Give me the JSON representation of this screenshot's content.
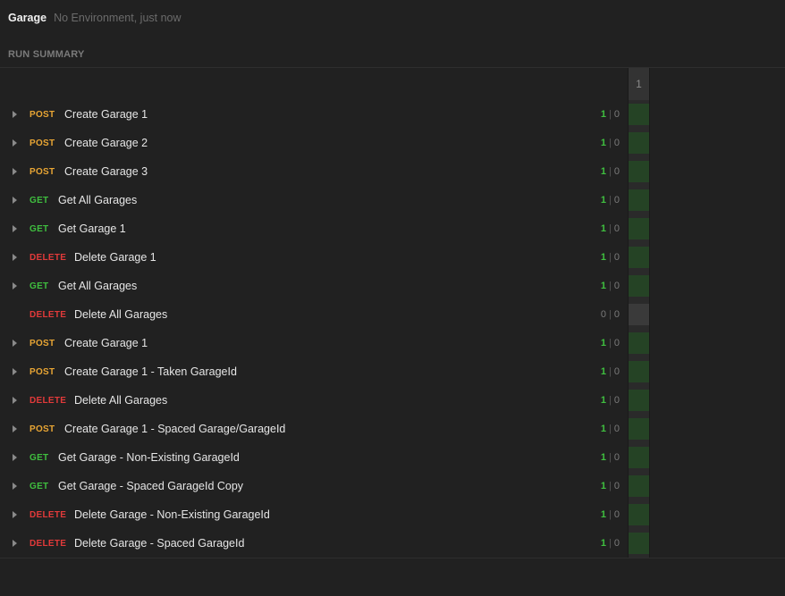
{
  "header": {
    "collection": "Garage",
    "meta": "No Environment, just now"
  },
  "section_label": "RUN SUMMARY",
  "iteration_label": "1",
  "colors": {
    "post": "#e8a534",
    "get": "#3fbf3f",
    "delete": "#e23a3a",
    "pass_cell": "#254325"
  },
  "requests": [
    {
      "method": "POST",
      "name": "Create Garage 1",
      "passed": "1",
      "failed": "0",
      "expandable": true
    },
    {
      "method": "POST",
      "name": "Create Garage 2",
      "passed": "1",
      "failed": "0",
      "expandable": true
    },
    {
      "method": "POST",
      "name": "Create Garage 3",
      "passed": "1",
      "failed": "0",
      "expandable": true
    },
    {
      "method": "GET",
      "name": "Get All Garages",
      "passed": "1",
      "failed": "0",
      "expandable": true
    },
    {
      "method": "GET",
      "name": "Get Garage 1",
      "passed": "1",
      "failed": "0",
      "expandable": true
    },
    {
      "method": "DELETE",
      "name": "Delete Garage 1",
      "passed": "1",
      "failed": "0",
      "expandable": true
    },
    {
      "method": "GET",
      "name": "Get All Garages",
      "passed": "1",
      "failed": "0",
      "expandable": true
    },
    {
      "method": "DELETE",
      "name": "Delete All Garages",
      "passed": "0",
      "failed": "0",
      "expandable": false
    },
    {
      "method": "POST",
      "name": "Create Garage 1",
      "passed": "1",
      "failed": "0",
      "expandable": true
    },
    {
      "method": "POST",
      "name": "Create Garage 1 - Taken GarageId",
      "passed": "1",
      "failed": "0",
      "expandable": true
    },
    {
      "method": "DELETE",
      "name": "Delete All Garages",
      "passed": "1",
      "failed": "0",
      "expandable": true
    },
    {
      "method": "POST",
      "name": "Create Garage 1 - Spaced Garage/GarageId",
      "passed": "1",
      "failed": "0",
      "expandable": true
    },
    {
      "method": "GET",
      "name": "Get Garage - Non-Existing GarageId",
      "passed": "1",
      "failed": "0",
      "expandable": true
    },
    {
      "method": "GET",
      "name": "Get Garage - Spaced GarageId Copy",
      "passed": "1",
      "failed": "0",
      "expandable": true
    },
    {
      "method": "DELETE",
      "name": "Delete Garage - Non-Existing GarageId",
      "passed": "1",
      "failed": "0",
      "expandable": true
    },
    {
      "method": "DELETE",
      "name": "Delete Garage - Spaced GarageId",
      "passed": "1",
      "failed": "0",
      "expandable": true
    }
  ]
}
